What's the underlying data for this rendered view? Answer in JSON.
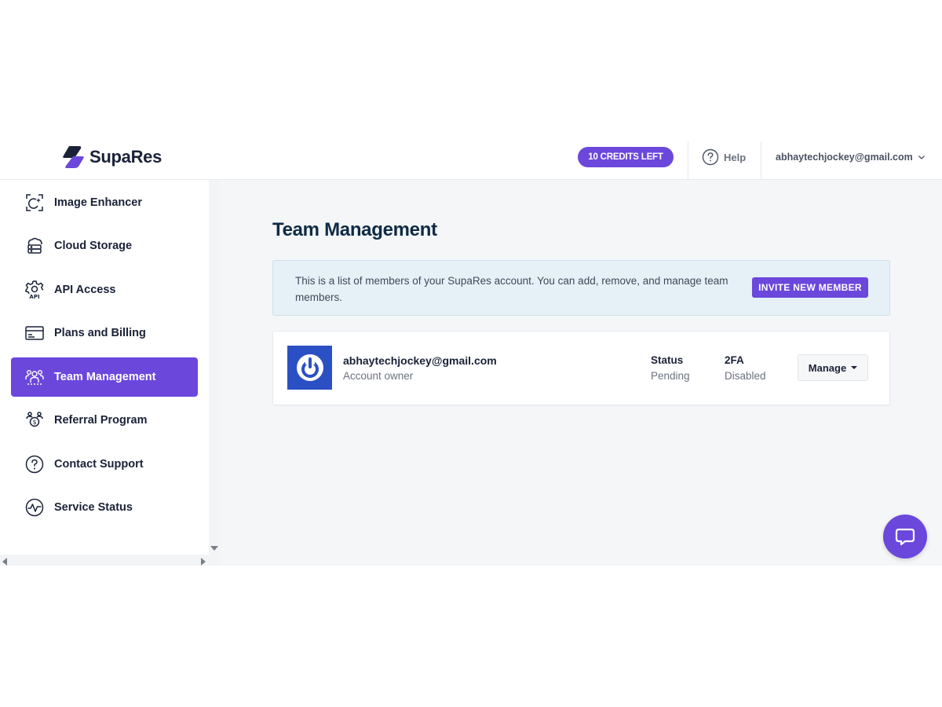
{
  "brand": {
    "name": "SupaRes",
    "color": "#6b47dc"
  },
  "header": {
    "credits_label": "10 CREDITS LEFT",
    "help_label": "Help",
    "user_email": "abhaytechjockey@gmail.com"
  },
  "sidebar": {
    "items": [
      {
        "label": "Image Enhancer",
        "icon": "image-enhancer-icon",
        "active": false
      },
      {
        "label": "Cloud Storage",
        "icon": "cloud-storage-icon",
        "active": false
      },
      {
        "label": "API Access",
        "icon": "api-gear-icon",
        "active": false
      },
      {
        "label": "Plans and Billing",
        "icon": "billing-card-icon",
        "active": false
      },
      {
        "label": "Team Management",
        "icon": "team-icon",
        "active": true
      },
      {
        "label": "Referral Program",
        "icon": "referral-icon",
        "active": false
      },
      {
        "label": "Contact Support",
        "icon": "question-circle-icon",
        "active": false
      },
      {
        "label": "Service Status",
        "icon": "status-pulse-icon",
        "active": false
      }
    ]
  },
  "main": {
    "title": "Team Management",
    "info_text": "This is a list of members of your SupaRes account. You can add, remove, and manage team members.",
    "invite_label": "INVITE NEW MEMBER",
    "members": [
      {
        "email": "abhaytechjockey@gmail.com",
        "role": "Account owner",
        "status_header": "Status",
        "status_value": "Pending",
        "twofa_header": "2FA",
        "twofa_value": "Disabled",
        "manage_label": "Manage"
      }
    ]
  },
  "colors": {
    "accent": "#6b47dc",
    "avatar_bg": "#2a50c4",
    "info_bg": "#e6f0f7",
    "main_bg": "#f4f6f8"
  }
}
